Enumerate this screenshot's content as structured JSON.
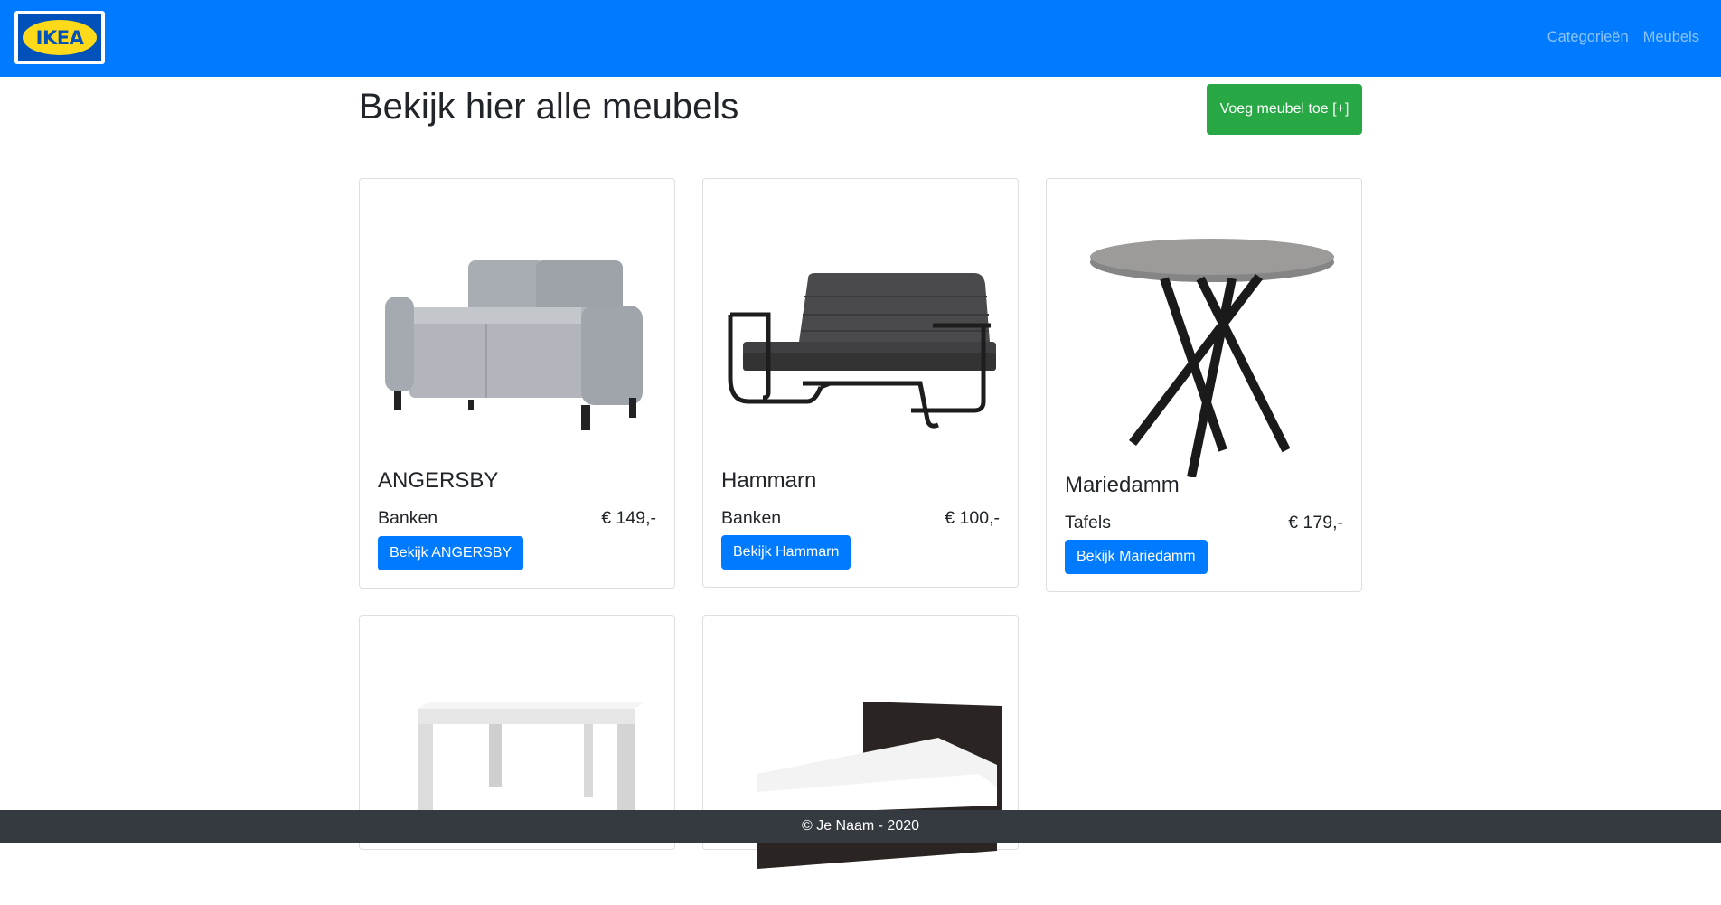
{
  "brand": {
    "logo_text": "IKEA",
    "colors": {
      "navbar": "#007bff",
      "logo_blue": "#0051ba",
      "logo_yellow": "#ffda1a"
    }
  },
  "nav": {
    "links": [
      {
        "label": "Categorieën"
      },
      {
        "label": "Meubels"
      }
    ]
  },
  "main": {
    "title": "Bekijk hier alle meubels",
    "add_button": "Voeg meubel toe [+]",
    "add_button_color": "#28a745",
    "products": [
      {
        "name": "ANGERSBY",
        "category": "Banken",
        "price": "€ 149,-",
        "button": "Bekijk ANGERSBY",
        "image": "sofa-image"
      },
      {
        "name": "Hammarn",
        "category": "Banken",
        "price": "€ 100,-",
        "button": "Bekijk Hammarn",
        "image": "sofa-bed-image"
      },
      {
        "name": "Mariedamm",
        "category": "Tafels",
        "price": "€ 179,-",
        "button": "Bekijk Mariedamm",
        "image": "round-table-image"
      },
      {
        "image": "white-table-image"
      },
      {
        "image": "bed-image"
      }
    ]
  },
  "footer": {
    "text": "© Je Naam - 2020"
  }
}
